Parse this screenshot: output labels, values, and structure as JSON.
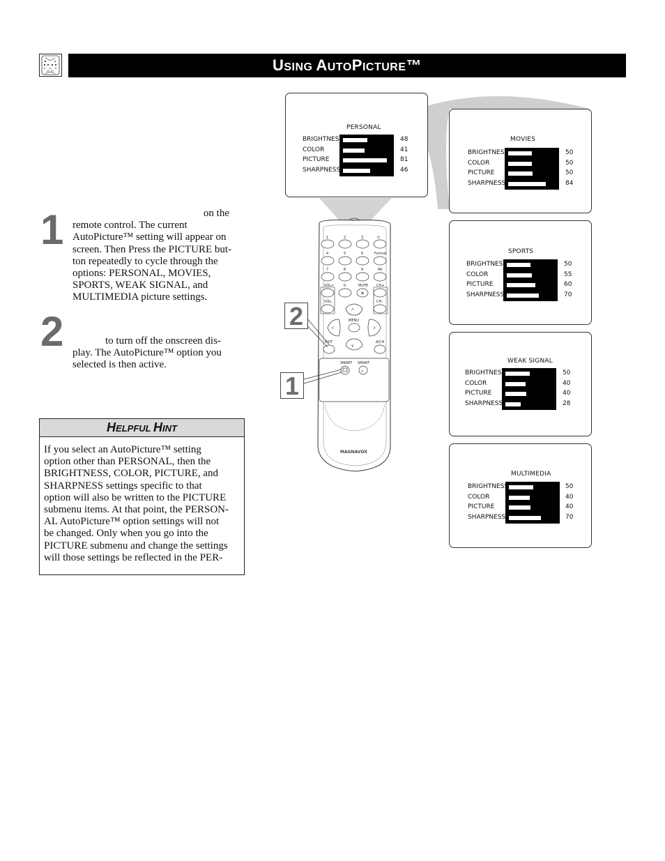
{
  "header": {
    "title_parts": [
      {
        "big": "U",
        "small": "SING "
      },
      {
        "big": "A",
        "small": "UTO"
      },
      {
        "big": "P",
        "small": "ICTURE"
      },
      {
        "big": "™",
        "small": ""
      }
    ],
    "icon": "remote-control-icon"
  },
  "steps": [
    {
      "number": "1",
      "lines": [
        "on the",
        "remote control. The current",
        "AutoPicture™  setting will appear on",
        "screen. Then Press the PICTURE but-",
        "ton repeatedly to cycle through the",
        "options: PERSONAL, MOVIES,",
        "SPORTS, WEAK SIGNAL, and",
        "MULTIMEDIA picture settings."
      ]
    },
    {
      "number": "2",
      "lines": [
        "to turn off the onscreen dis-",
        "play. The AutoPicture™ option you",
        "selected is then active."
      ]
    }
  ],
  "hint": {
    "title_parts": [
      {
        "big": "H",
        "small": "ELPFUL "
      },
      {
        "big": "H",
        "small": "INT"
      }
    ],
    "lines": [
      "If you select an AutoPicture™ setting",
      "option other than PERSONAL, then the",
      "BRIGHTNESS, COLOR, PICTURE, and",
      "SHARPNESS settings specific to that",
      "option will also be written to the PICTURE",
      "submenu items. At that point, the PERSON-",
      "AL AutoPicture™ option settings will not",
      "be changed. Only when you go into the",
      "PICTURE submenu and change the settings",
      "will those settings be reflected in the PER-"
    ]
  },
  "screens": [
    {
      "title": "PERSONAL",
      "settings": [
        {
          "label": "BRIGHTNESS",
          "value": "48",
          "fill": 0.48
        },
        {
          "label": "COLOR",
          "value": "41",
          "fill": 0.55
        },
        {
          "label": "PICTURE",
          "value": "81",
          "fill": 0.07
        },
        {
          "label": "SHARPNESS",
          "value": "46",
          "fill": 0.43
        }
      ]
    },
    {
      "title": "MOVIES",
      "settings": [
        {
          "label": "BRIGHTNESS",
          "value": "50",
          "fill": 0.5
        },
        {
          "label": "COLOR",
          "value": "50",
          "fill": 0.5
        },
        {
          "label": "PICTURE",
          "value": "50",
          "fill": 0.48
        },
        {
          "label": "SHARPNESS",
          "value": "84",
          "fill": 0.2
        }
      ]
    },
    {
      "title": "SPORTS",
      "settings": [
        {
          "label": "BRIGHTNESS",
          "value": "50",
          "fill": 0.5
        },
        {
          "label": "COLOR",
          "value": "55",
          "fill": 0.47
        },
        {
          "label": "PICTURE",
          "value": "60",
          "fill": 0.4
        },
        {
          "label": "SHARPNESS",
          "value": "70",
          "fill": 0.32
        }
      ]
    },
    {
      "title": "WEAK  SIGNAL",
      "settings": [
        {
          "label": "BRIGHTNESS",
          "value": "50",
          "fill": 0.49
        },
        {
          "label": "COLOR",
          "value": "40",
          "fill": 0.58
        },
        {
          "label": "PICTURE",
          "value": "40",
          "fill": 0.56
        },
        {
          "label": "SHARPNESS",
          "value": "28",
          "fill": 0.68
        }
      ]
    },
    {
      "title": "MULTIMEDIA",
      "settings": [
        {
          "label": "BRIGHTNESS",
          "value": "50",
          "fill": 0.48
        },
        {
          "label": "COLOR",
          "value": "40",
          "fill": 0.56
        },
        {
          "label": "PICTURE",
          "value": "40",
          "fill": 0.55
        },
        {
          "label": "SHARPNESS",
          "value": "70",
          "fill": 0.33
        }
      ]
    }
  ],
  "remote": {
    "brand": "MAGNAVOX",
    "buttons": {
      "b1": "1",
      "b2": "2",
      "b3": "3",
      "power": "⏻",
      "b4": "4",
      "b5": "5",
      "b6": "6",
      "format": "Format",
      "b7": "7",
      "b8": "8",
      "b9": "9",
      "av": "AV",
      "vol_up": "VOL+",
      "b0": "0",
      "mute": "MUTE",
      "ch_up": "CH+",
      "vol_down": "VOL-",
      "ch_down": "CH-",
      "menu": "MENU",
      "exit": "EXIT",
      "ach": "A/CH",
      "smart_picture": "SMART",
      "smart_sound": "SMART"
    },
    "callouts": [
      "1",
      "2"
    ]
  }
}
